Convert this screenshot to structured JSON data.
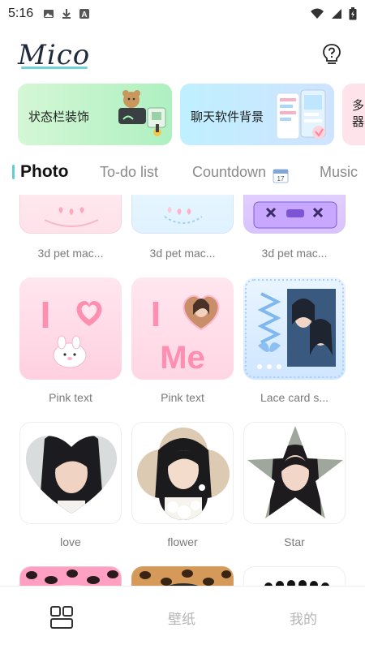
{
  "status_bar": {
    "time": "5:16",
    "left_icons": [
      "image-icon",
      "download-icon",
      "a-icon"
    ],
    "right_icons": [
      "wifi-icon",
      "signal-icon",
      "battery-icon"
    ]
  },
  "header": {
    "logo": "Mico",
    "help_icon": "lightbulb-question-icon",
    "accent": "#6fd3d8"
  },
  "banners": [
    {
      "label": "状态栏装饰"
    },
    {
      "label": "聊天软件背景"
    },
    {
      "label": "多器"
    }
  ],
  "tabs": [
    {
      "label": "Photo",
      "active": true
    },
    {
      "label": "To-do list",
      "active": false
    },
    {
      "label": "Countdown",
      "active": false
    },
    {
      "label": "Music",
      "active": false
    }
  ],
  "grid": {
    "items": [
      {
        "label": "3d pet mac..."
      },
      {
        "label": "3d pet mac..."
      },
      {
        "label": "3d pet mac..."
      },
      {
        "label": "Pink text"
      },
      {
        "label": "Pink text"
      },
      {
        "label": "Lace card s..."
      },
      {
        "label": "love"
      },
      {
        "label": "flower"
      },
      {
        "label": "Star"
      }
    ],
    "pink_text_1": "I",
    "pink_text_2_top": "I",
    "pink_text_2_bottom": "Me"
  },
  "bottom_nav": {
    "items": [
      {
        "label": "",
        "icon": "widgets-icon",
        "active": true
      },
      {
        "label": "壁纸"
      },
      {
        "label": "我的"
      }
    ]
  }
}
